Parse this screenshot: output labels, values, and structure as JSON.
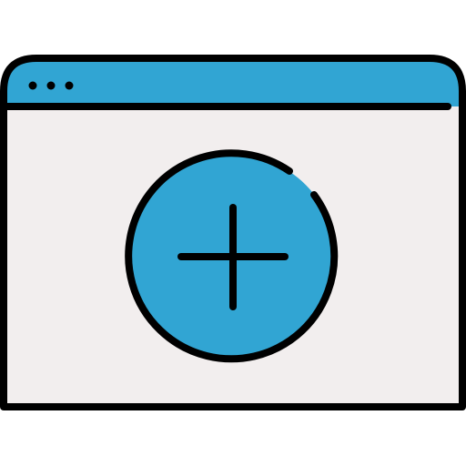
{
  "icon": {
    "name": "browser-window-add-icon",
    "symbol": "plus"
  },
  "window": {
    "title_bar_dots": 3
  },
  "colors": {
    "accent": "#31A5D3",
    "window_fill": "#F2EEEE",
    "outline": "#000000",
    "background": "#FFFFFF"
  }
}
